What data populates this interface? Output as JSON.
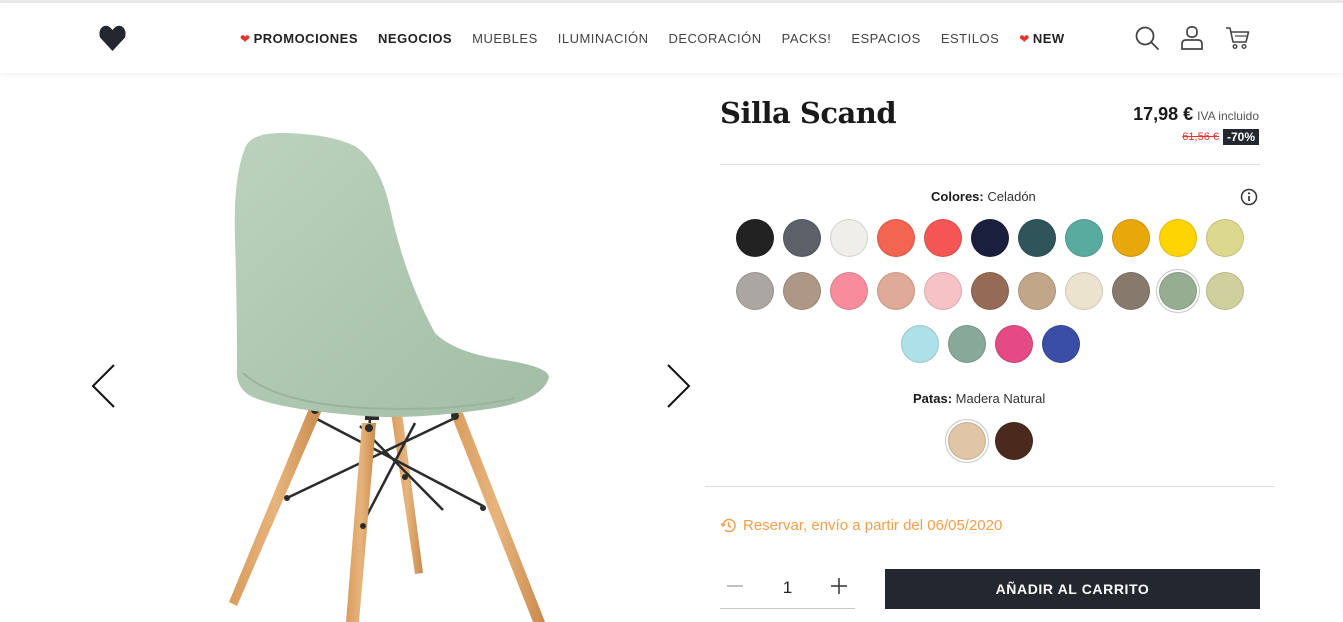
{
  "nav": {
    "items": [
      {
        "label": "PROMOCIONES",
        "heart": true,
        "bold": true
      },
      {
        "label": "NEGOCIOS",
        "heart": false,
        "bold": true
      },
      {
        "label": "MUEBLES",
        "heart": false,
        "bold": false
      },
      {
        "label": "ILUMINACIÓN",
        "heart": false,
        "bold": false
      },
      {
        "label": "DECORACIÓN",
        "heart": false,
        "bold": false
      },
      {
        "label": "PACKS!",
        "heart": false,
        "bold": false
      },
      {
        "label": "ESPACIOS",
        "heart": false,
        "bold": false
      },
      {
        "label": "ESTILOS",
        "heart": false,
        "bold": false
      },
      {
        "label": "NEW",
        "heart": true,
        "bold": true
      }
    ],
    "icons": [
      "search-icon",
      "user-icon",
      "cart-icon"
    ]
  },
  "product": {
    "title": "Silla Scand",
    "price": "17,98 €",
    "price_note": "IVA incluido",
    "old_price": "61,56 €",
    "discount": "-70%"
  },
  "colors": {
    "label": "Colores:",
    "selected": "Celadón",
    "swatches": [
      "#222222",
      "#5c6068",
      "#f0eeea",
      "#f36451",
      "#f55555",
      "#1a1f3d",
      "#2f555a",
      "#5aab9f",
      "#e8a70a",
      "#ffd400",
      "#dcd88e",
      "#aaa6a2",
      "#ad9885",
      "#f88c9c",
      "#e0aa98",
      "#f6c2c6",
      "#956b55",
      "#c1a68a",
      "#ebe3cd",
      "#877a6c",
      "#97ad92",
      "#d0d09e",
      "#aee0ea",
      "#88a89a",
      "#e44a85",
      "#3b4ea6"
    ],
    "selected_index": 20
  },
  "legs": {
    "label": "Patas:",
    "selected": "Madera Natural",
    "swatches": [
      "#e0c6a6",
      "#4a2a1c"
    ],
    "selected_index": 0
  },
  "reserve": {
    "text": "Reservar, envío a partir del 06/05/2020"
  },
  "cart": {
    "quantity": "1",
    "button_label": "AÑADIR AL CARRITO"
  }
}
